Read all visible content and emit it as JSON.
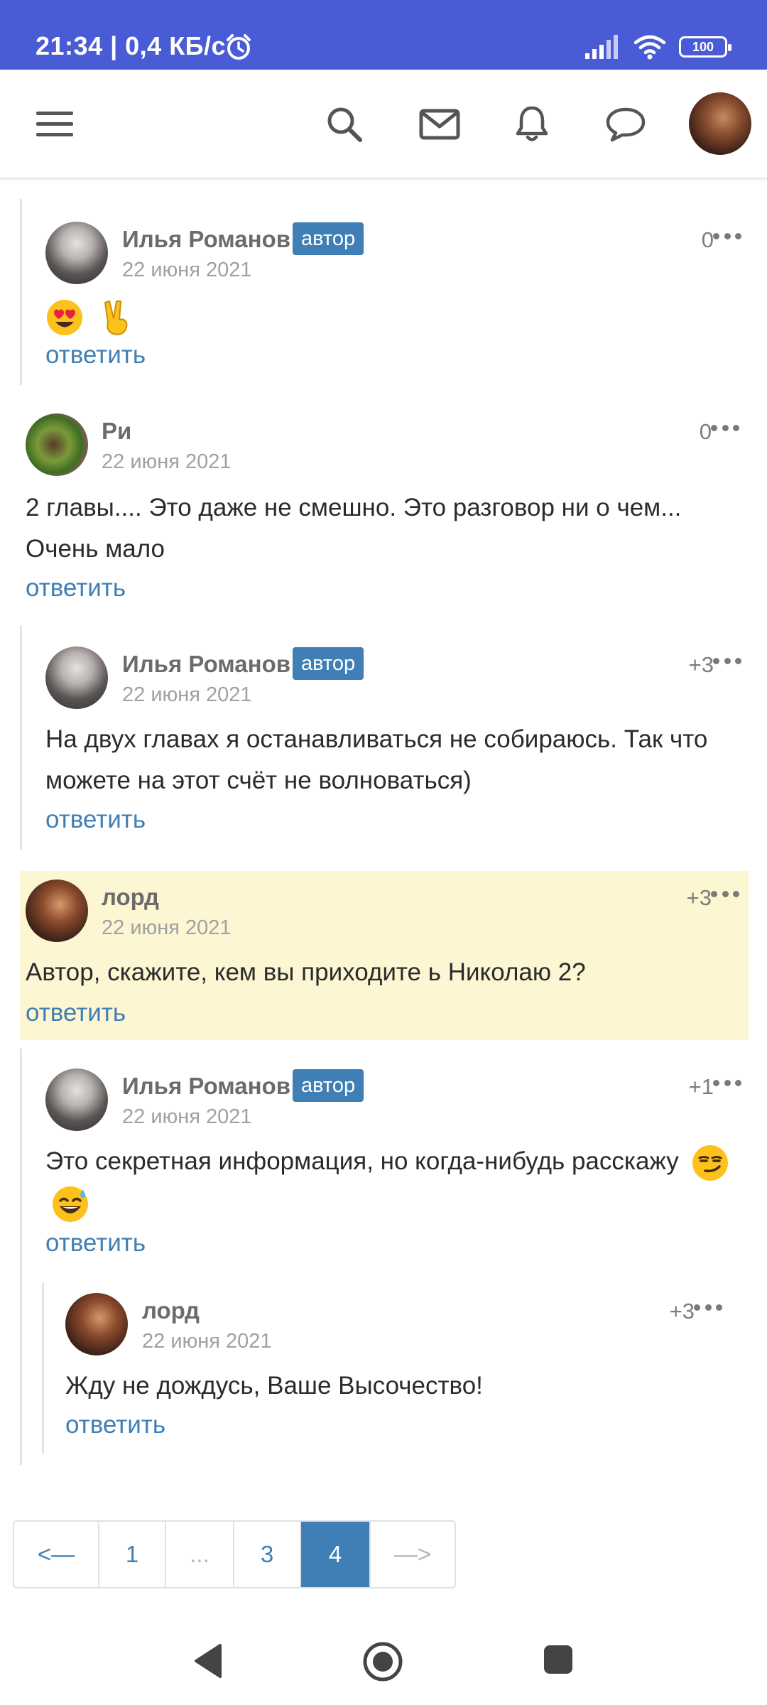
{
  "status": {
    "time": "21:34 | 0,4 КБ/с",
    "battery": "100"
  },
  "topbar": {
    "menu": "menu-icon",
    "search": "search-icon",
    "mail": "mail-icon",
    "bell": "bell-icon",
    "chat": "chat-icon"
  },
  "labels": {
    "reply": "ответить",
    "author_badge": "автор"
  },
  "comments": [
    {
      "author": "Илья Романов",
      "date": "22 июня 2021",
      "score": "0",
      "text": "",
      "emojis": [
        "heart-eyes-emoji",
        "victory-hand-emoji"
      ]
    },
    {
      "author": "Ри",
      "date": "22 июня 2021",
      "score": "0",
      "text": "2 главы.... Это даже не смешно. Это разговор ни о чем... Очень мало"
    },
    {
      "author": "Илья Романов",
      "date": "22 июня 2021",
      "score": "+3",
      "text": "На двух главах я останавливаться не собираюсь. Так что можете на этот счёт не волноваться)"
    },
    {
      "author": "лорд",
      "date": "22 июня 2021",
      "score": "+3",
      "text": "Автор, скажите, кем вы приходите ь Николаю 2?"
    },
    {
      "author": "Илья Романов",
      "date": "22 июня 2021",
      "score": "+1",
      "text": "Это секретная информация, но когда-нибудь расскажу",
      "emojis": [
        "smirk-emoji",
        "sweat-smile-emoji"
      ]
    },
    {
      "author": "лорд",
      "date": "22 июня 2021",
      "score": "+3",
      "text": "Жду не дождусь, Ваше Высочество!"
    }
  ],
  "pagination": {
    "prev": "<—",
    "p1": "1",
    "ellipsis": "...",
    "p3": "3",
    "p4": "4",
    "next": "—>"
  }
}
